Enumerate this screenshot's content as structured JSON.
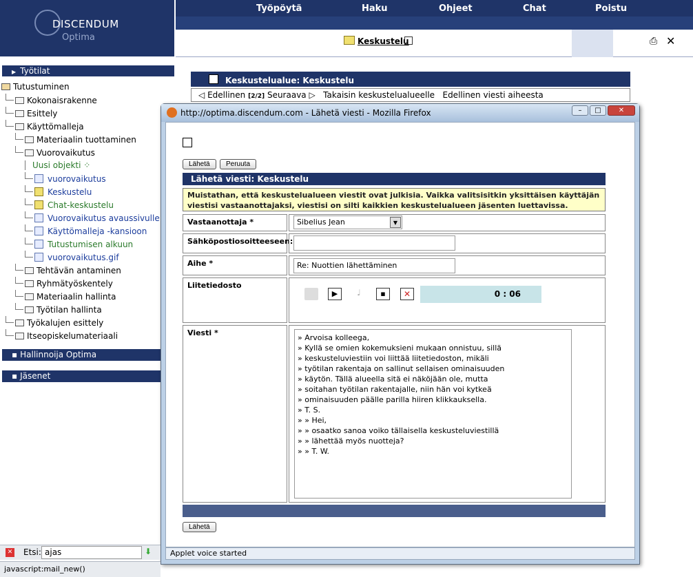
{
  "left": {
    "logo_title": "DISCENDUM",
    "logo_sub": "Optima",
    "workspaces_label": "Työtilat",
    "tree": [
      {
        "label": "Tutustuminen"
      },
      {
        "label": "Kokonaisrakenne"
      },
      {
        "label": "Esittely"
      },
      {
        "label": "Käyttömalleja"
      },
      {
        "label": "Materiaalin tuottaminen"
      },
      {
        "label": "Vuorovaikutus"
      },
      {
        "label": "Uusi objekti"
      },
      {
        "label": "vuorovaikutus"
      },
      {
        "label": "Keskustelu"
      },
      {
        "label": "Chat-keskustelu"
      },
      {
        "label": "Vuorovaikutus avaussivulle"
      },
      {
        "label": "Käyttömalleja -kansioon"
      },
      {
        "label": "Tutustumisen alkuun"
      },
      {
        "label": "vuorovaikutus.gif"
      },
      {
        "label": "Tehtävän antaminen"
      },
      {
        "label": "Ryhmätyöskentely"
      },
      {
        "label": "Materiaalin hallinta"
      },
      {
        "label": "Työtilan hallinta"
      },
      {
        "label": "Työkalujen esittely"
      },
      {
        "label": "Itseopiskelumateriaali"
      }
    ],
    "admin_label": "Hallinnoija Optima",
    "members_label": "Jäsenet"
  },
  "topnav": {
    "items": [
      "Työpöytä",
      "Haku",
      "Ohjeet",
      "Chat",
      "Poistu"
    ]
  },
  "tab_title": "Keskustelu",
  "background": {
    "area_title": "Keskustelualue: Keskustelu",
    "nav_prev": "Edellinen",
    "nav_page": "[2/2]",
    "nav_next": "Seuraava",
    "nav_back": "Takaisin keskustelualueelle",
    "nav_prev_msg": "Edellinen viesti aiheesta"
  },
  "popup": {
    "window_title": "http://optima.discendum.com - Lähetä viesti - Mozilla Firefox",
    "send_label": "Lähetä",
    "cancel_label": "Peruuta",
    "header": "Lähetä viesti: Keskustelu",
    "warning": "Muistathan, että keskustelualueen viestit ovat julkisia. Vaikka valitsisitkin yksittäisen käyttäjän viestisi vastaanottajaksi, viestisi on silti kaikkien keskustelualueen jäsenten luettavissa.",
    "recipient_label": "Vastaanottaja *",
    "recipient_value": "Sibelius Jean",
    "email_label": "Sähköpostiosoitteeseen:",
    "email_value": "",
    "subject_label": "Aihe *",
    "subject_value": "Re: Nuottien lähettäminen",
    "attachment_label": "Liitetiedosto",
    "timer": "0 : 06",
    "message_label": "Viesti *",
    "message_lines": [
      "» Arvoisa kolleega,",
      "» Kyllä se omien kokemuksieni mukaan onnistuu, sillä",
      "» keskusteluviestiin voi liittää liitetiedoston, mikäli",
      "» työtilan rakentaja on sallinut sellaisen ominaisuuden",
      "» käytön. Tällä alueella sitä ei näköjään ole, mutta",
      "» soitahan työtilan rakentajalle, niin hän voi kytkeä",
      "» ominaisuuden päälle parilla hiiren klikkauksella.",
      "» T. S.",
      "» » Hei,",
      "» » osaatko sanoa voiko tällaisella keskusteluviestillä",
      "» » lähettää myös nuotteja?",
      "» » T. W."
    ],
    "status": "Applet voice started"
  },
  "findbar": {
    "label": "Etsi:",
    "value": "ajas"
  },
  "js_status": "javascript:mail_new()"
}
